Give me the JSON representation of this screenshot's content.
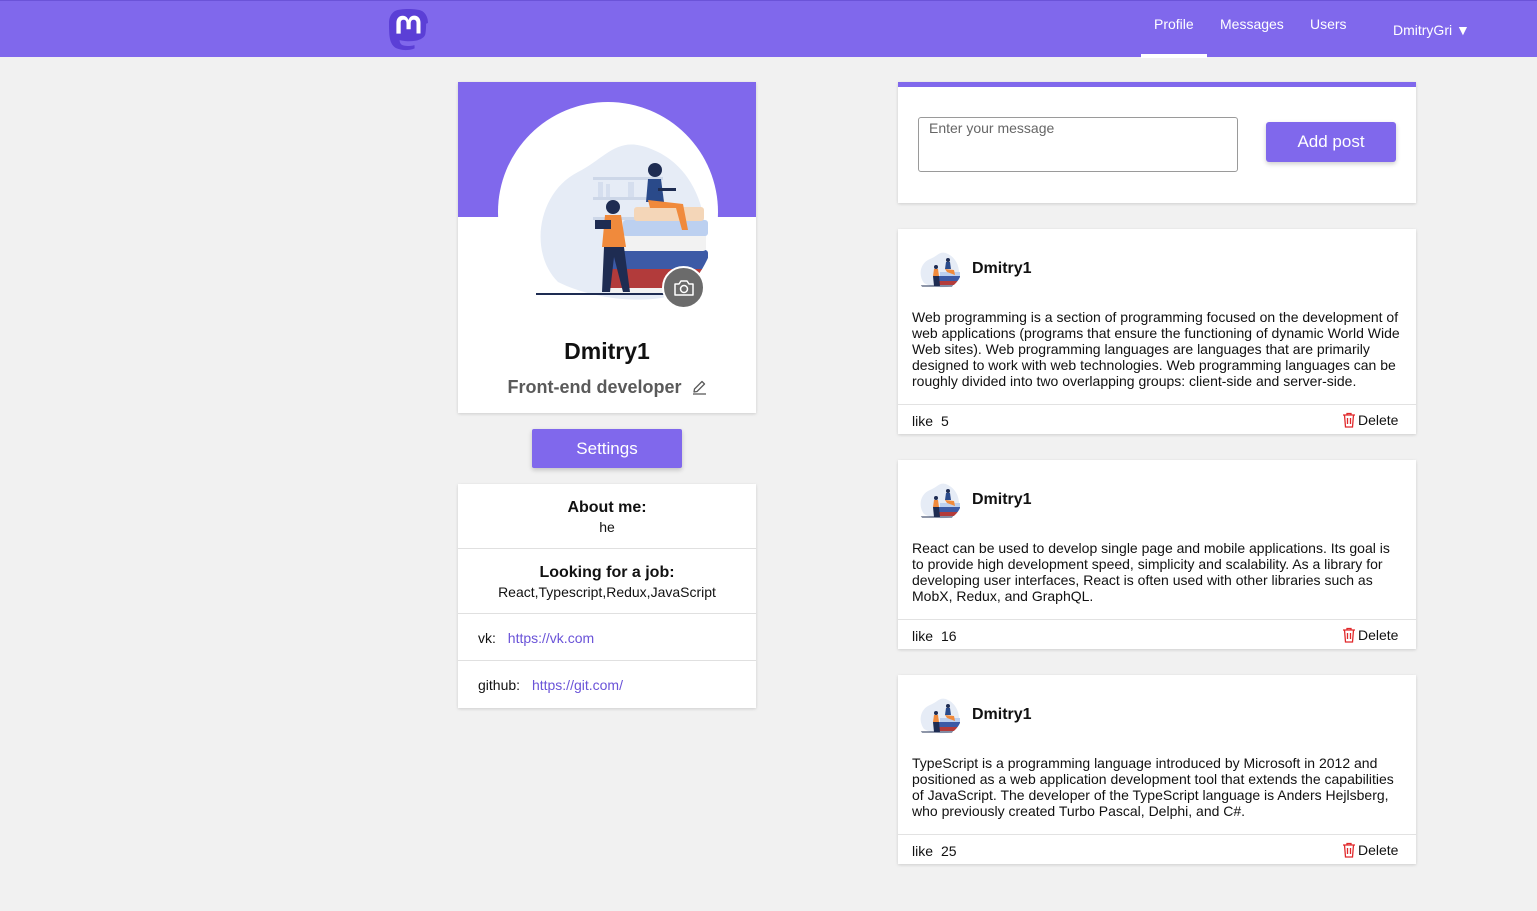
{
  "header": {
    "logo_icon": "mastodon-logo-icon",
    "nav": [
      {
        "label": "Profile",
        "active": true
      },
      {
        "label": "Messages",
        "active": false
      },
      {
        "label": "Users",
        "active": false
      }
    ],
    "user_menu": "DmitryGri ▼"
  },
  "profile": {
    "name": "Dmitry1",
    "status": "Front-end developer",
    "settings_label": "Settings",
    "about_title": "About me:",
    "about_value": "he",
    "job_title": "Looking for a job:",
    "job_value": "React,Typescript,Redux,JavaScript",
    "links": [
      {
        "label": "vk:",
        "url": "https://vk.com"
      },
      {
        "label": "github:",
        "url": "https://git.com/"
      }
    ]
  },
  "composer": {
    "placeholder": "Enter your message",
    "value": "",
    "button_label": "Add post"
  },
  "posts": [
    {
      "author": "Dmitry1",
      "text": "Web programming is a section of programming focused on the development of web applications (programs that ensure the functioning of dynamic World Wide Web sites). Web programming languages are languages that are primarily designed to work with web technologies. Web programming languages can be roughly divided into two overlapping groups: client-side and server-side.",
      "like_label": "like",
      "likes": "5",
      "delete_label": "Delete"
    },
    {
      "author": "Dmitry1",
      "text": "React can be used to develop single page and mobile applications. Its goal is to provide high development speed, simplicity and scalability. As a library for developing user interfaces, React is often used with other libraries such as MobX, Redux, and GraphQL.",
      "like_label": "like",
      "likes": "16",
      "delete_label": "Delete"
    },
    {
      "author": "Dmitry1",
      "text": "TypeScript is a programming language introduced by Microsoft in 2012 and positioned as a web application development tool that extends the capabilities of JavaScript. The developer of the TypeScript language is Anders Hejlsberg, who previously created Turbo Pascal, Delphi, and C#.",
      "like_label": "like",
      "likes": "25",
      "delete_label": "Delete"
    }
  ],
  "colors": {
    "accent": "#8068ec",
    "link": "#6a53d8",
    "delete_icon": "#e0282a"
  }
}
